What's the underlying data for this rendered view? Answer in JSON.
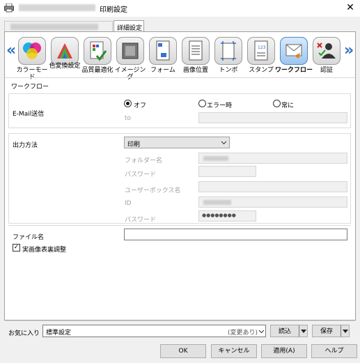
{
  "window": {
    "title": "印刷設定",
    "close_glyph": "✕"
  },
  "tabs": [
    {
      "label": "詳細設定"
    }
  ],
  "iconbar": {
    "prev_glyph": "«",
    "next_glyph": "»",
    "items": [
      {
        "label": "カラーモード",
        "icon": "color-mode-icon"
      },
      {
        "label": "色変換設定",
        "icon": "color-conversion-icon"
      },
      {
        "label": "品質最適化",
        "icon": "quality-icon"
      },
      {
        "label": "イメージング",
        "icon": "imaging-icon"
      },
      {
        "label": "フォーム",
        "icon": "form-icon"
      },
      {
        "label": "画像位置",
        "icon": "image-position-icon"
      },
      {
        "label": "トンボ",
        "icon": "crop-mark-icon"
      },
      {
        "label": "スタンプ",
        "icon": "stamp-icon"
      },
      {
        "label": "ワークフロー",
        "icon": "workflow-icon",
        "selected": true
      },
      {
        "label": "認証",
        "icon": "auth-icon"
      }
    ]
  },
  "workflow": {
    "section_title": "ワークフロー",
    "email_label": "E-Mail送信",
    "radio_off": "オフ",
    "radio_error": "エラー時",
    "radio_always": "常に",
    "to_label": "to",
    "output_label": "出力方法",
    "output_value": "印刷",
    "folder_label": "フォルダー名",
    "password_label": "パスワード",
    "userbox_label": "ユーザーボックス名",
    "id_label": "ID",
    "password2_label": "パスワード",
    "password2_value": "●●●●●●●●",
    "filename_label": "ファイル名",
    "adjust_label": "実画像表裏調整",
    "adjust_checked_glyph": "✓"
  },
  "favorites": {
    "label": "お気に入り",
    "value": "標準設定",
    "changed": "(変更あり)",
    "load": "読込",
    "save": "保存"
  },
  "footer": {
    "ok": "OK",
    "cancel": "キャンセル",
    "apply": "適用(A)",
    "help": "ヘルプ"
  },
  "colors": {
    "accent": "#2f70c0",
    "selected_icon": "#9ec6ee"
  }
}
